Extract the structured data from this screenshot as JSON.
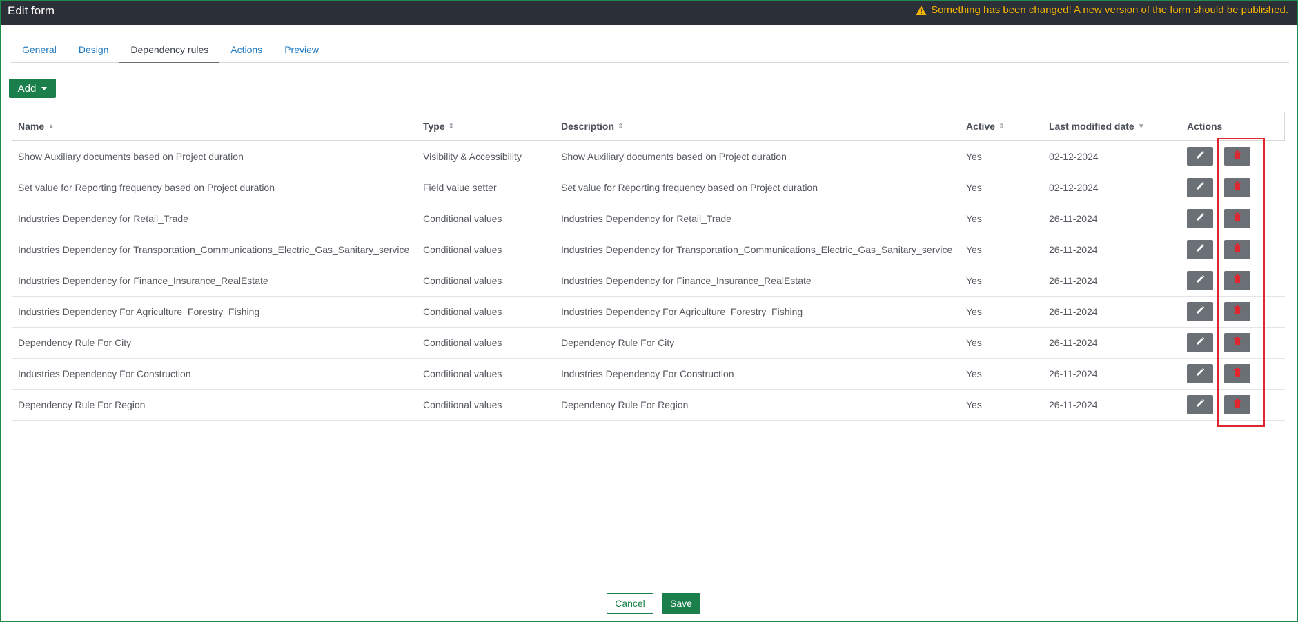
{
  "header": {
    "title": "Edit form",
    "warning": "Something has been changed! A new version of the form should be published."
  },
  "tabs": [
    {
      "label": "General"
    },
    {
      "label": "Design"
    },
    {
      "label": "Dependency rules",
      "active": true
    },
    {
      "label": "Actions"
    },
    {
      "label": "Preview"
    }
  ],
  "toolbar": {
    "add_label": "Add"
  },
  "table": {
    "columns": {
      "name": "Name",
      "type": "Type",
      "description": "Description",
      "active": "Active",
      "modified": "Last modified date",
      "actions": "Actions"
    },
    "rows": [
      {
        "name": "Show Auxiliary documents based on Project duration",
        "type": "Visibility & Accessibility",
        "description": "Show Auxiliary documents based on Project duration",
        "active": "Yes",
        "modified": "02-12-2024"
      },
      {
        "name": "Set value for Reporting frequency based on Project duration",
        "type": "Field value setter",
        "description": "Set value for Reporting frequency based on Project duration",
        "active": "Yes",
        "modified": "02-12-2024"
      },
      {
        "name": "Industries Dependency for Retail_Trade",
        "type": "Conditional values",
        "description": "Industries Dependency for Retail_Trade",
        "active": "Yes",
        "modified": "26-11-2024"
      },
      {
        "name": "Industries Dependency for Transportation_Communications_Electric_Gas_Sanitary_service",
        "type": "Conditional values",
        "description": "Industries Dependency for Transportation_Communications_Electric_Gas_Sanitary_service",
        "active": "Yes",
        "modified": "26-11-2024"
      },
      {
        "name": "Industries Dependency for Finance_Insurance_RealEstate",
        "type": "Conditional values",
        "description": "Industries Dependency for Finance_Insurance_RealEstate",
        "active": "Yes",
        "modified": "26-11-2024"
      },
      {
        "name": "Industries Dependency For Agriculture_Forestry_Fishing",
        "type": "Conditional values",
        "description": "Industries Dependency For Agriculture_Forestry_Fishing",
        "active": "Yes",
        "modified": "26-11-2024"
      },
      {
        "name": "Dependency Rule For City",
        "type": "Conditional values",
        "description": "Dependency Rule For City",
        "active": "Yes",
        "modified": "26-11-2024"
      },
      {
        "name": "Industries Dependency For Construction",
        "type": "Conditional values",
        "description": "Industries Dependency For Construction",
        "active": "Yes",
        "modified": "26-11-2024"
      },
      {
        "name": "Dependency Rule For Region",
        "type": "Conditional values",
        "description": "Dependency Rule For Region",
        "active": "Yes",
        "modified": "26-11-2024"
      }
    ]
  },
  "footer": {
    "cancel_label": "Cancel",
    "save_label": "Save"
  },
  "colors": {
    "accent": "#1a7f4a",
    "warning": "#f4b400",
    "header_bg": "#2b2f38",
    "delete_icon": "#e0262f"
  },
  "icons": {
    "edit": "pencil-icon",
    "delete": "trash-icon",
    "warning": "warning-triangle-icon"
  }
}
